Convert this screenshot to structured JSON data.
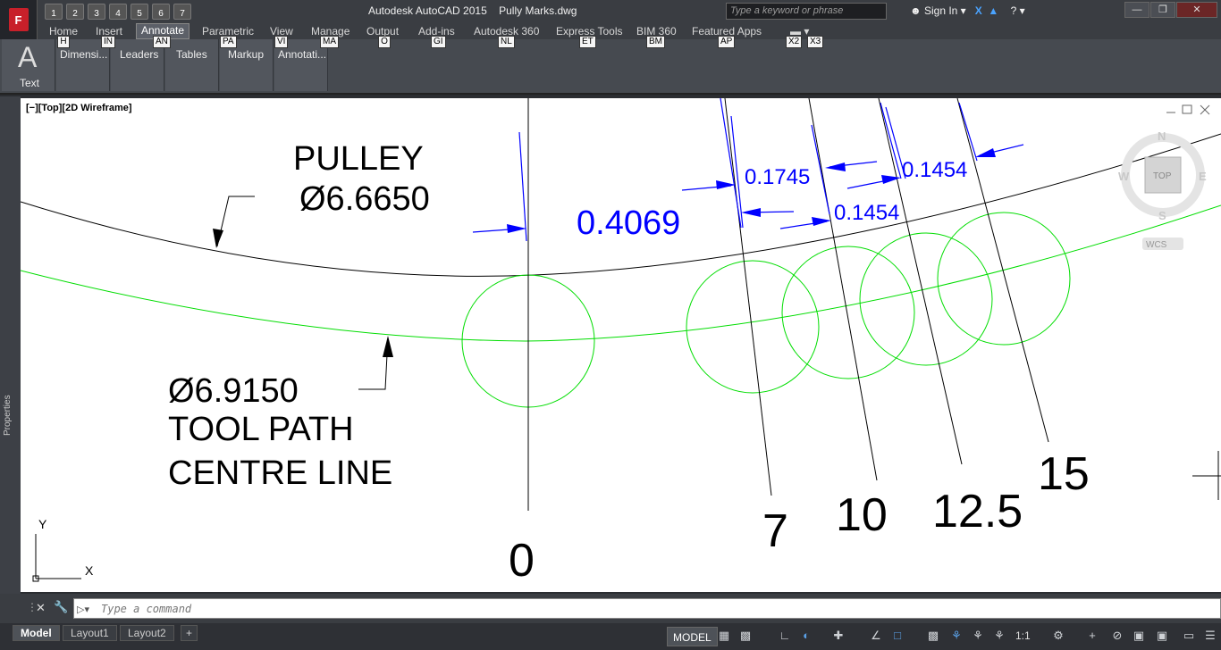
{
  "title": {
    "app": "Autodesk AutoCAD 2015",
    "file": "Pully Marks.dwg"
  },
  "app_button": {
    "label": "F"
  },
  "quick_access": [
    "1",
    "2",
    "3",
    "4",
    "5",
    "6",
    "7"
  ],
  "search": {
    "placeholder": "Type a keyword or phrase"
  },
  "account": {
    "signin_label": "Sign In"
  },
  "ribbon_tabs": [
    {
      "label": "Home",
      "key": "H"
    },
    {
      "label": "Insert",
      "key": "IN"
    },
    {
      "label": "Annotate",
      "key": "AN",
      "active": true
    },
    {
      "label": "Parametric",
      "key": "PA"
    },
    {
      "label": "View",
      "key": "VI"
    },
    {
      "label": "Manage",
      "key": "MA"
    },
    {
      "label": "Output",
      "key": "O"
    },
    {
      "label": "Add-ins",
      "key": "GI"
    },
    {
      "label": "Autodesk 360",
      "key": "NL"
    },
    {
      "label": "Express Tools",
      "key": "ET"
    },
    {
      "label": "BIM 360",
      "key": "BM"
    },
    {
      "label": "Featured Apps",
      "key": "AP"
    }
  ],
  "extra_keytips": [
    "X2",
    "X3"
  ],
  "ribbon_panels": [
    {
      "label": "Text",
      "icon": "text-A-icon"
    },
    {
      "label": "Dimensi..."
    },
    {
      "label": "Leaders"
    },
    {
      "label": "Tables"
    },
    {
      "label": "Markup"
    },
    {
      "label": "Annotati..."
    }
  ],
  "side_palette": {
    "label": "Properties"
  },
  "viewport": {
    "label": "[−][Top][2D Wireframe]",
    "viewcube": {
      "n": "N",
      "s": "S",
      "e": "E",
      "w": "W",
      "face": "TOP",
      "wcs": "WCS"
    },
    "ucs": {
      "x": "X",
      "y": "Y"
    }
  },
  "drawing": {
    "pulley_label": "PULLEY",
    "pulley_dia": "Ø6.6650",
    "toolpath_dia": "Ø6.9150",
    "toolpath_line1": "TOOL PATH",
    "toolpath_line2": "CENTRE LINE",
    "dim_main": "0.4069",
    "dims": [
      "0.1745",
      "0.1454",
      "0.1454"
    ],
    "marks": [
      "0",
      "7",
      "10",
      "12.5",
      "15"
    ],
    "colors": {
      "blue": "#0000ff",
      "green": "#00dd00",
      "black": "#000000"
    }
  },
  "command": {
    "placeholder": "Type a command"
  },
  "layout_tabs": [
    "Model",
    "Layout1",
    "Layout2"
  ],
  "status": {
    "model_label": "MODEL",
    "scale": "1:1"
  }
}
